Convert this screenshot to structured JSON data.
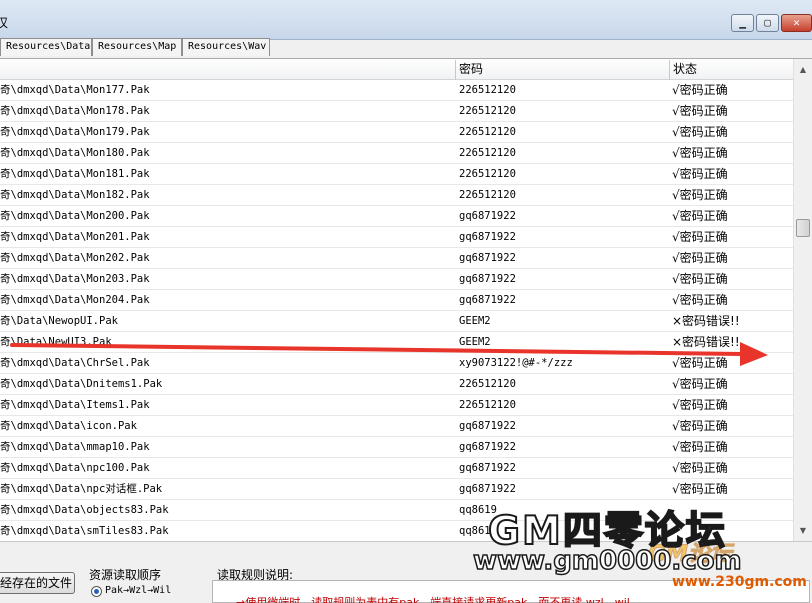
{
  "window": {
    "title": "汉",
    "min_icon": "minimize-icon",
    "max_icon": "maximize-icon",
    "close_icon": "close-icon",
    "min_glyph": "▁",
    "max_glyph": "▢",
    "close_glyph": "✕"
  },
  "tabs": [
    {
      "label": "Resources\\Data"
    },
    {
      "label": "Resources\\Map"
    },
    {
      "label": "Resources\\Wav"
    }
  ],
  "columns": {
    "path": "",
    "password": "密码",
    "status": "状态"
  },
  "rows": [
    {
      "path": "奇\\dmxqd\\Data\\Mon177.Pak",
      "password": "226512120",
      "status": "√密码正确"
    },
    {
      "path": "奇\\dmxqd\\Data\\Mon178.Pak",
      "password": "226512120",
      "status": "√密码正确"
    },
    {
      "path": "奇\\dmxqd\\Data\\Mon179.Pak",
      "password": "226512120",
      "status": "√密码正确"
    },
    {
      "path": "奇\\dmxqd\\Data\\Mon180.Pak",
      "password": "226512120",
      "status": "√密码正确"
    },
    {
      "path": "奇\\dmxqd\\Data\\Mon181.Pak",
      "password": "226512120",
      "status": "√密码正确"
    },
    {
      "path": "奇\\dmxqd\\Data\\Mon182.Pak",
      "password": "226512120",
      "status": "√密码正确"
    },
    {
      "path": "奇\\dmxqd\\Data\\Mon200.Pak",
      "password": "gq6871922",
      "status": "√密码正确"
    },
    {
      "path": "奇\\dmxqd\\Data\\Mon201.Pak",
      "password": "gq6871922",
      "status": "√密码正确"
    },
    {
      "path": "奇\\dmxqd\\Data\\Mon202.Pak",
      "password": "gq6871922",
      "status": "√密码正确"
    },
    {
      "path": "奇\\dmxqd\\Data\\Mon203.Pak",
      "password": "gq6871922",
      "status": "√密码正确"
    },
    {
      "path": "奇\\dmxqd\\Data\\Mon204.Pak",
      "password": "gq6871922",
      "status": "√密码正确"
    },
    {
      "path": "奇\\Data\\NewopUI.Pak",
      "password": "GEEM2",
      "status": "×密码错误!!"
    },
    {
      "path": "奇\\Data\\NewUI3.Pak",
      "password": "GEEM2",
      "status": "×密码错误!!"
    },
    {
      "path": "奇\\dmxqd\\Data\\ChrSel.Pak",
      "password": "xy9073122!@#-*/zzz",
      "status": "√密码正确"
    },
    {
      "path": "奇\\dmxqd\\Data\\Dnitems1.Pak",
      "password": "226512120",
      "status": "√密码正确"
    },
    {
      "path": "奇\\dmxqd\\Data\\Items1.Pak",
      "password": "226512120",
      "status": "√密码正确"
    },
    {
      "path": "奇\\dmxqd\\Data\\icon.Pak",
      "password": "gq6871922",
      "status": "√密码正确"
    },
    {
      "path": "奇\\dmxqd\\Data\\mmap10.Pak",
      "password": "gq6871922",
      "status": "√密码正确"
    },
    {
      "path": "奇\\dmxqd\\Data\\npc100.Pak",
      "password": "gq6871922",
      "status": "√密码正确"
    },
    {
      "path": "奇\\dmxqd\\Data\\npc对话框.Pak",
      "password": "gq6871922",
      "status": "√密码正确"
    },
    {
      "path": "奇\\dmxqd\\Data\\objects83.Pak",
      "password": "qq8619",
      "status": ""
    },
    {
      "path": "奇\\dmxqd\\Data\\smTiles83.Pak",
      "password": "qq8619",
      "status": ""
    }
  ],
  "scrollbar": {
    "up_glyph": "▲",
    "down_glyph": "▼"
  },
  "bottom": {
    "open_button": "经存在的文件",
    "order_title": "资源读取顺序",
    "order_option": "Pak→Wzl→Wil",
    "rules_title": "读取规则说明:",
    "rules_text": "→使用微端时，读取规则为表中有pak，端直接请求更新pak，而不再读 wzl、wil"
  },
  "watermark": {
    "main": "GM四零论坛",
    "url": "www.gm0000.com",
    "gm": "GM论坛",
    "url2": "www.230gm.com"
  },
  "colors": {
    "arrow": "#e8342a",
    "error_text": "#c00000"
  }
}
